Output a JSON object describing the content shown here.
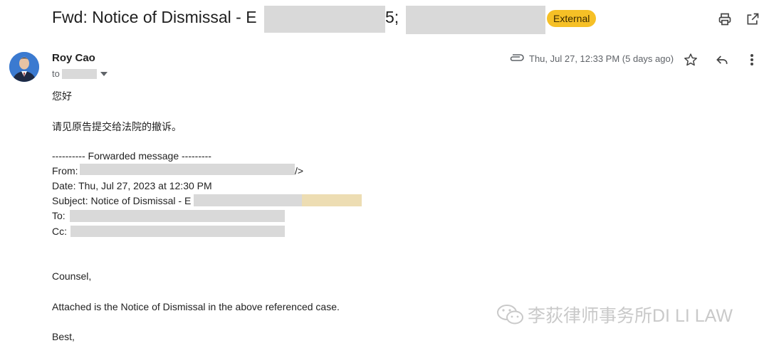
{
  "email": {
    "subject_prefix": "Fwd: Notice of Dismissal - E",
    "subject_fragment": "5;",
    "badge": "External",
    "sender_name": "Roy Cao",
    "to_label": "to",
    "date": "Thu, Jul 27, 12:33 PM (5 days ago)"
  },
  "body": {
    "greeting": "您好",
    "note": "请见原告提交给法院的撤诉。",
    "forward_header": "---------- Forwarded message ---------",
    "from_label": "From:",
    "from_tail": "/>",
    "date_line": "Date: Thu, Jul 27, 2023 at 12:30 PM",
    "subject_line_prefix": "Subject: Notice of Dismissal - E",
    "to_line": "To:",
    "cc_line": "Cc:",
    "counsel": "Counsel,",
    "attached": "Attached is the Notice of Dismissal in the above referenced case.",
    "best": "Best,"
  },
  "watermark": {
    "text": "李荻律师事务所DI LI LAW",
    "icon": "wechat-icon"
  },
  "icons": [
    "print-icon",
    "open-in-new-icon",
    "attachment-icon",
    "star-icon",
    "reply-icon",
    "more-vert-icon",
    "dropdown-icon"
  ],
  "colors": {
    "badge": "#f6c026",
    "redaction": "#d9d9d9"
  }
}
